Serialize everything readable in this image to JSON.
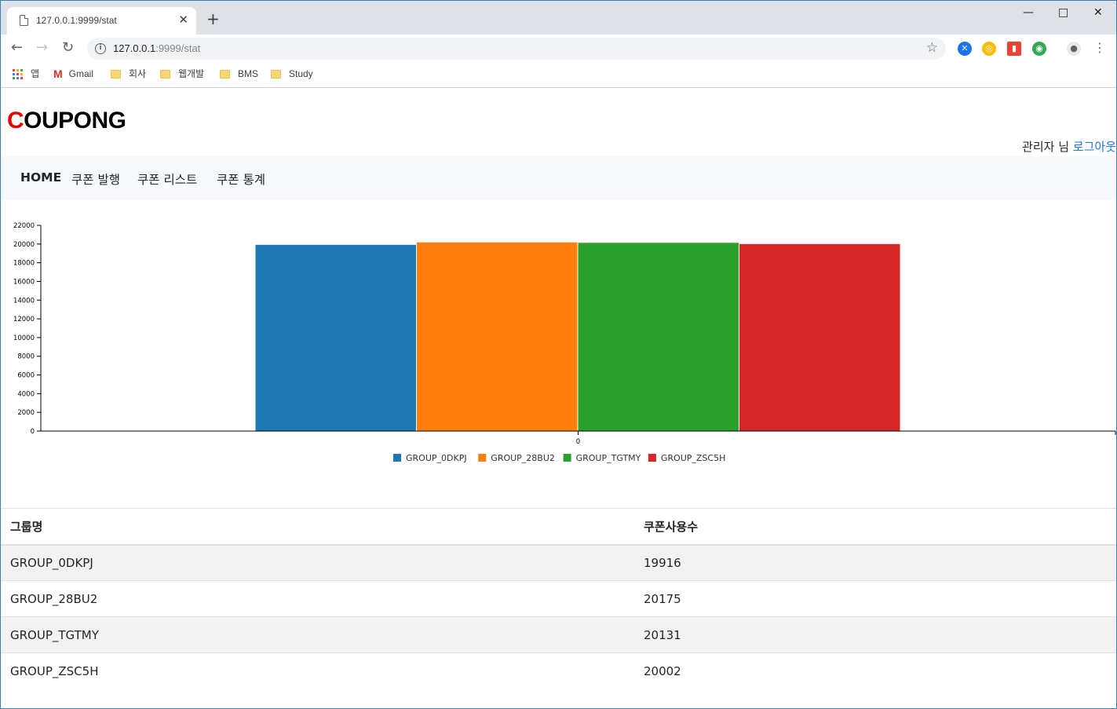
{
  "browser": {
    "tab_title": "127.0.0.1:9999/stat",
    "url_host": "127.0.0.1",
    "url_path": ":9999/stat",
    "bookmarks": [
      {
        "label": "앱",
        "icon": "apps-icon"
      },
      {
        "label": "Gmail",
        "icon": "gmail-icon"
      },
      {
        "label": "회사",
        "icon": "folder-icon"
      },
      {
        "label": "웹개발",
        "icon": "folder-icon"
      },
      {
        "label": "BMS",
        "icon": "folder-icon"
      },
      {
        "label": "Study",
        "icon": "folder-icon"
      }
    ]
  },
  "header": {
    "logo_first": "C",
    "logo_rest": "OUPONG",
    "user_label": "관리자 님",
    "logout_label": "로그아웃"
  },
  "nav": {
    "home": "HOME",
    "issue": "쿠폰 발행",
    "list": "쿠폰 리스트",
    "stats": "쿠폰 통계"
  },
  "chart_data": {
    "type": "bar",
    "categories": [
      "0"
    ],
    "series": [
      {
        "name": "GROUP_0DKPJ",
        "values": [
          19916
        ],
        "color": "#1f77b4"
      },
      {
        "name": "GROUP_28BU2",
        "values": [
          20175
        ],
        "color": "#ff7f0e"
      },
      {
        "name": "GROUP_TGTMY",
        "values": [
          20131
        ],
        "color": "#2ca02c"
      },
      {
        "name": "GROUP_ZSC5H",
        "values": [
          20002
        ],
        "color": "#d62728"
      }
    ],
    "ylim": [
      0,
      22000
    ],
    "yticks": [
      0,
      2000,
      4000,
      6000,
      8000,
      10000,
      12000,
      14000,
      16000,
      18000,
      20000,
      22000
    ],
    "legend": "bottom-center",
    "grid": false
  },
  "table": {
    "headers": [
      "그룹명",
      "쿠폰사용수"
    ],
    "rows": [
      [
        "GROUP_0DKPJ",
        "19916"
      ],
      [
        "GROUP_28BU2",
        "20175"
      ],
      [
        "GROUP_TGTMY",
        "20131"
      ],
      [
        "GROUP_ZSC5H",
        "20002"
      ]
    ]
  }
}
